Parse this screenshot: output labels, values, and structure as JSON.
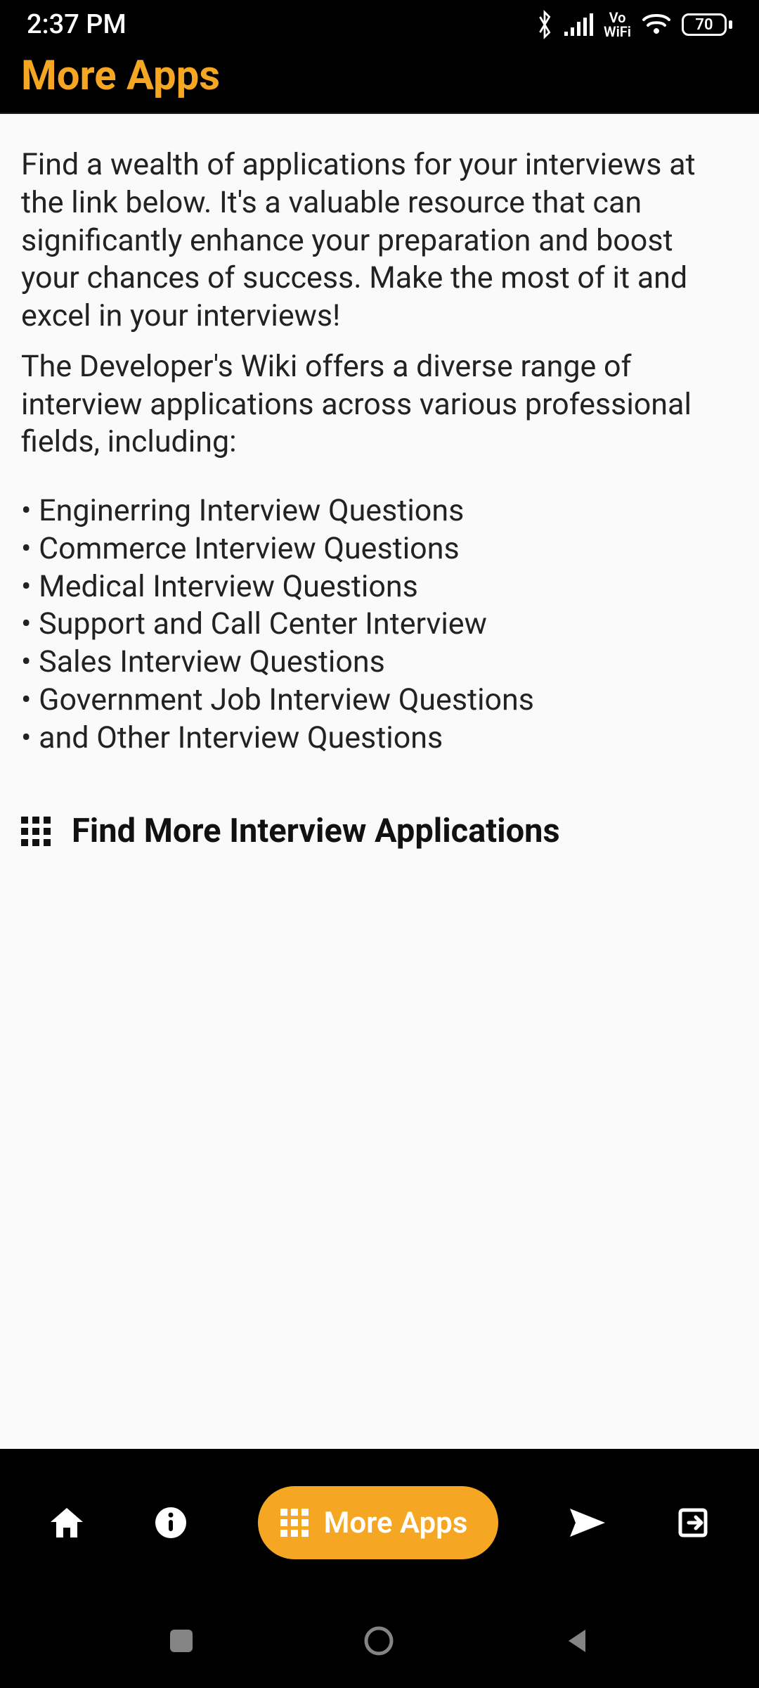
{
  "status": {
    "time": "2:37 PM",
    "vo_top": "Vo",
    "vo_bottom": "WiFi",
    "battery": "70"
  },
  "appbar": {
    "title": "More Apps"
  },
  "content": {
    "para1": "Find a wealth of applications for your interviews at the link below. It's a valuable resource that can significantly enhance your preparation and boost your chances of success. Make the most of it and excel in your interviews!",
    "para2": "The Developer's Wiki offers a diverse range of interview applications across various professional fields, including:",
    "bullets": [
      "• Enginerring Interview Questions",
      "• Commerce Interview Questions",
      "• Medical Interview Questions",
      "• Support and Call Center Interview",
      "• Sales Interview Questions",
      "• Government Job Interview Questions",
      "• and Other Interview Questions"
    ],
    "find_more": "Find More Interview Applications"
  },
  "bottom_nav": {
    "more_apps": "More Apps"
  }
}
